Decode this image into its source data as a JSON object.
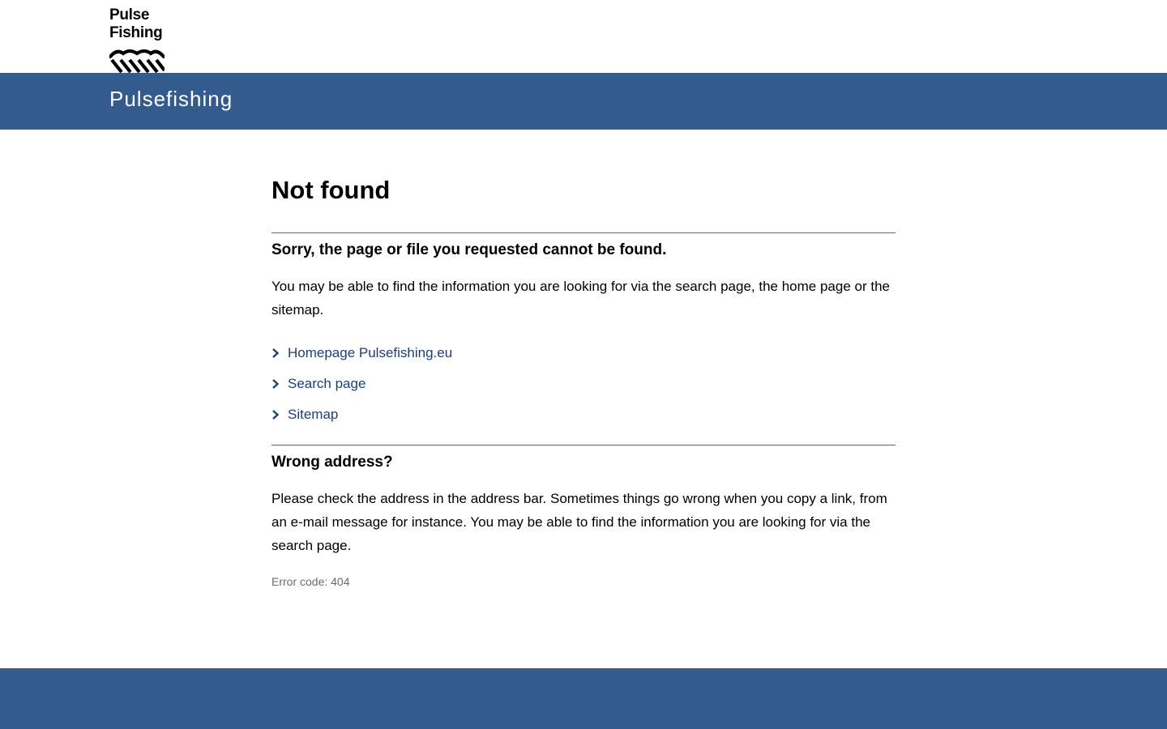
{
  "header": {
    "logo_line1": "Pulse",
    "logo_line2": "Fishing",
    "logo_icon": "waves-icon",
    "site_name": "Pulsefishing"
  },
  "main": {
    "title": "Not found",
    "section1": {
      "heading": "Sorry, the page or file you requested cannot be found.",
      "text": "You may be able to find the information you are looking for via the search page, the home page or the sitemap."
    },
    "links": [
      {
        "label": "Homepage Pulsefishing.eu",
        "icon": "chevron-right-icon"
      },
      {
        "label": "Search page",
        "icon": "chevron-right-icon"
      },
      {
        "label": "Sitemap",
        "icon": "chevron-right-icon"
      }
    ],
    "section2": {
      "heading": "Wrong address?",
      "text": "Please check the address in the address bar. Sometimes things go wrong when you copy a link, from an e-mail message for instance. You may be able to find the information you are looking for via the search page."
    },
    "error_code": "Error code: 404"
  },
  "colors": {
    "brand_blue": "#335b8e",
    "link_blue": "#1d3f73",
    "divider_red": "#b7432f",
    "muted_text": "#6b6b6b"
  }
}
